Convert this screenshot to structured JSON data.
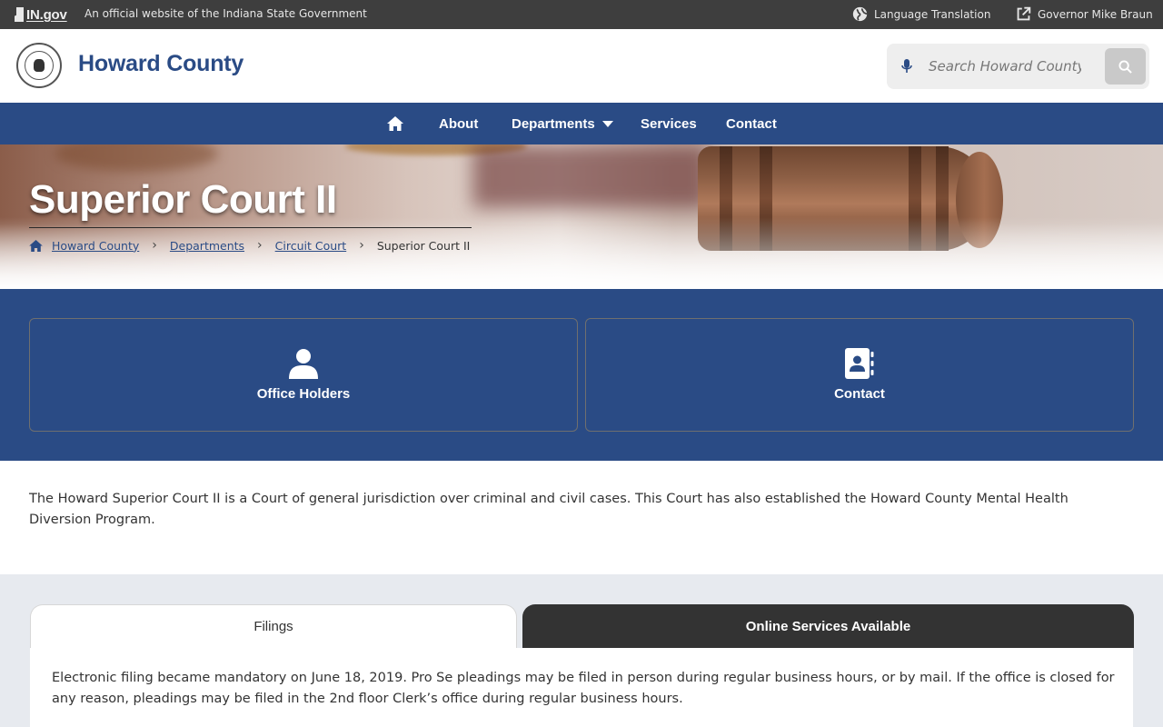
{
  "topbar": {
    "ingov_label": "IN.gov",
    "official_text": "An official website of the Indiana State Government",
    "language_label": "Language Translation",
    "governor_label": "Governor Mike Braun"
  },
  "header": {
    "site_title": "Howard County",
    "search_placeholder": "Search Howard County"
  },
  "nav": {
    "items": [
      {
        "label": "About"
      },
      {
        "label": "Departments"
      },
      {
        "label": "Services"
      },
      {
        "label": "Contact"
      }
    ]
  },
  "hero": {
    "title": "Superior Court II",
    "breadcrumb": [
      "Howard County",
      "Departments",
      "Circuit Court",
      "Superior Court II"
    ]
  },
  "quick_links": [
    {
      "label": "Office Holders",
      "icon": "person-icon"
    },
    {
      "label": "Contact",
      "icon": "contact-book-icon"
    }
  ],
  "intro_text": "The Howard Superior Court II is a Court of general jurisdiction over criminal and civil cases. This Court has also established the Howard County Mental Health Diversion Program.",
  "tabs": [
    {
      "label": "Filings",
      "active": true
    },
    {
      "label": "Online Services Available",
      "active": false
    }
  ],
  "tab_content": "Electronic filing became mandatory on June 18, 2019. Pro Se pleadings may be filed in person during regular business hours, or by mail.  If the office is closed for any reason, pleadings may be filed in the 2nd floor Clerk’s office during regular business hours.",
  "colors": {
    "brand_blue": "#2a4b85",
    "topbar": "#3e3e3e",
    "tab_dark": "#333333",
    "section_gray": "#e7eaef"
  }
}
